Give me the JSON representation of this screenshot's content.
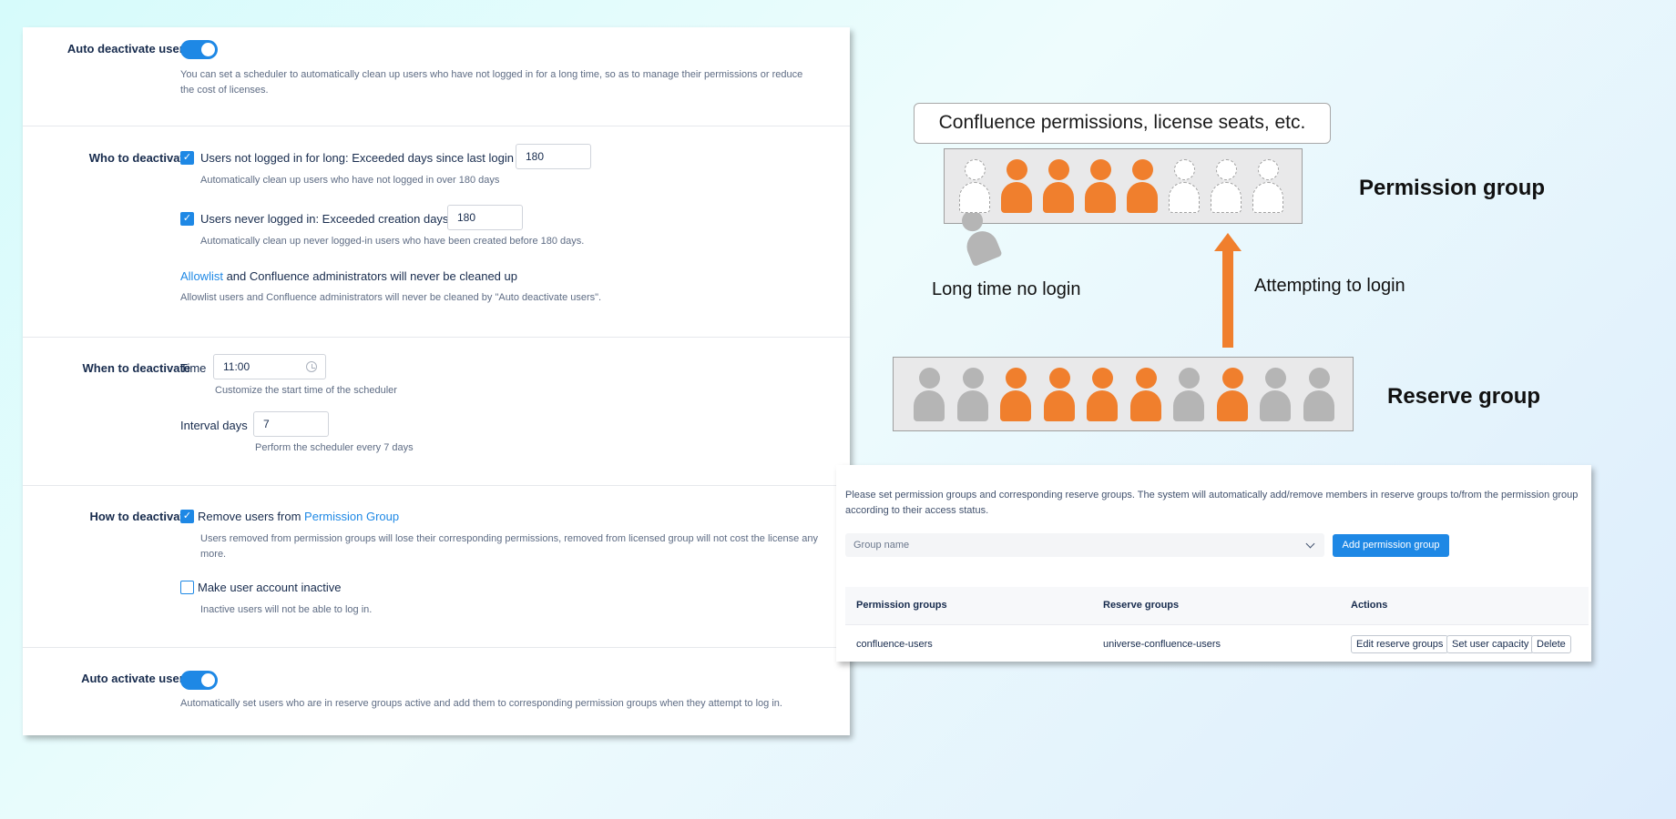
{
  "settings": {
    "auto_deactivate": {
      "label": "Auto deactivate users",
      "enabled": true,
      "desc": "You can set a scheduler to automatically clean up users who have not logged in for a long time, so as to manage their permissions or reduce the cost of licenses."
    },
    "who": {
      "label": "Who to deactivate",
      "not_logged": {
        "text": "Users not logged in for long: Exceeded days since last login",
        "value": "180",
        "desc": "Automatically clean up users who have not logged in over 180 days"
      },
      "never_logged": {
        "text": "Users never logged in: Exceeded creation days",
        "value": "180",
        "desc": "Automatically clean up never logged-in users who have been created before 180 days."
      },
      "allowlist_link": "Allowlist",
      "allowlist_text": " and Confluence administrators will never be cleaned up",
      "allowlist_desc": "Allowlist users and Confluence administrators will never be cleaned by \"Auto deactivate users\"."
    },
    "when": {
      "label": "When to deactivate",
      "time_label": "Time",
      "time_value": "11:00",
      "time_desc": "Customize the start time of the scheduler",
      "interval_label": "Interval days",
      "interval_value": "7",
      "interval_desc": "Perform the scheduler every 7 days"
    },
    "how": {
      "label": "How to deactivate",
      "remove_text": "Remove users from ",
      "remove_link": "Permission Group",
      "remove_desc": "Users removed from permission groups will lose their corresponding permissions, removed from licensed group will not cost the license any more.",
      "inactive_text": "Make user account inactive",
      "inactive_desc": "Inactive users will not be able to log in."
    },
    "auto_activate": {
      "label": "Auto activate users",
      "enabled": true,
      "desc": "Automatically set users who are in reserve groups active and add them to corresponding permission groups when they attempt to log in."
    }
  },
  "diagram": {
    "caption": "Confluence permissions, license seats, etc.",
    "permission_group_label": "Permission group",
    "reserve_group_label": "Reserve group",
    "long_time_label": "Long time no login",
    "attempting_label": "Attempting to login",
    "permission_slots": [
      "dashed",
      "orange",
      "orange",
      "orange",
      "orange",
      "dashed",
      "dashed",
      "dashed"
    ],
    "reserve_slots": [
      "gray",
      "gray",
      "orange",
      "orange",
      "orange",
      "orange",
      "gray",
      "orange",
      "gray",
      "gray"
    ],
    "colors": {
      "orange": "#f07f2d",
      "gray": "#b5b5b5"
    }
  },
  "perm_panel": {
    "intro": "Please set permission groups and corresponding reserve groups. The system will automatically add/remove members in reserve groups to/from the permission group according to their access status.",
    "select_placeholder": "Group name",
    "add_button": "Add permission group",
    "columns": [
      "Permission groups",
      "Reserve groups",
      "Actions"
    ],
    "rows": [
      {
        "permission_group": "confluence-users",
        "reserve_group": "universe-confluence-users",
        "actions": [
          "Edit reserve groups",
          "Set user capacity",
          "Delete"
        ]
      }
    ]
  }
}
